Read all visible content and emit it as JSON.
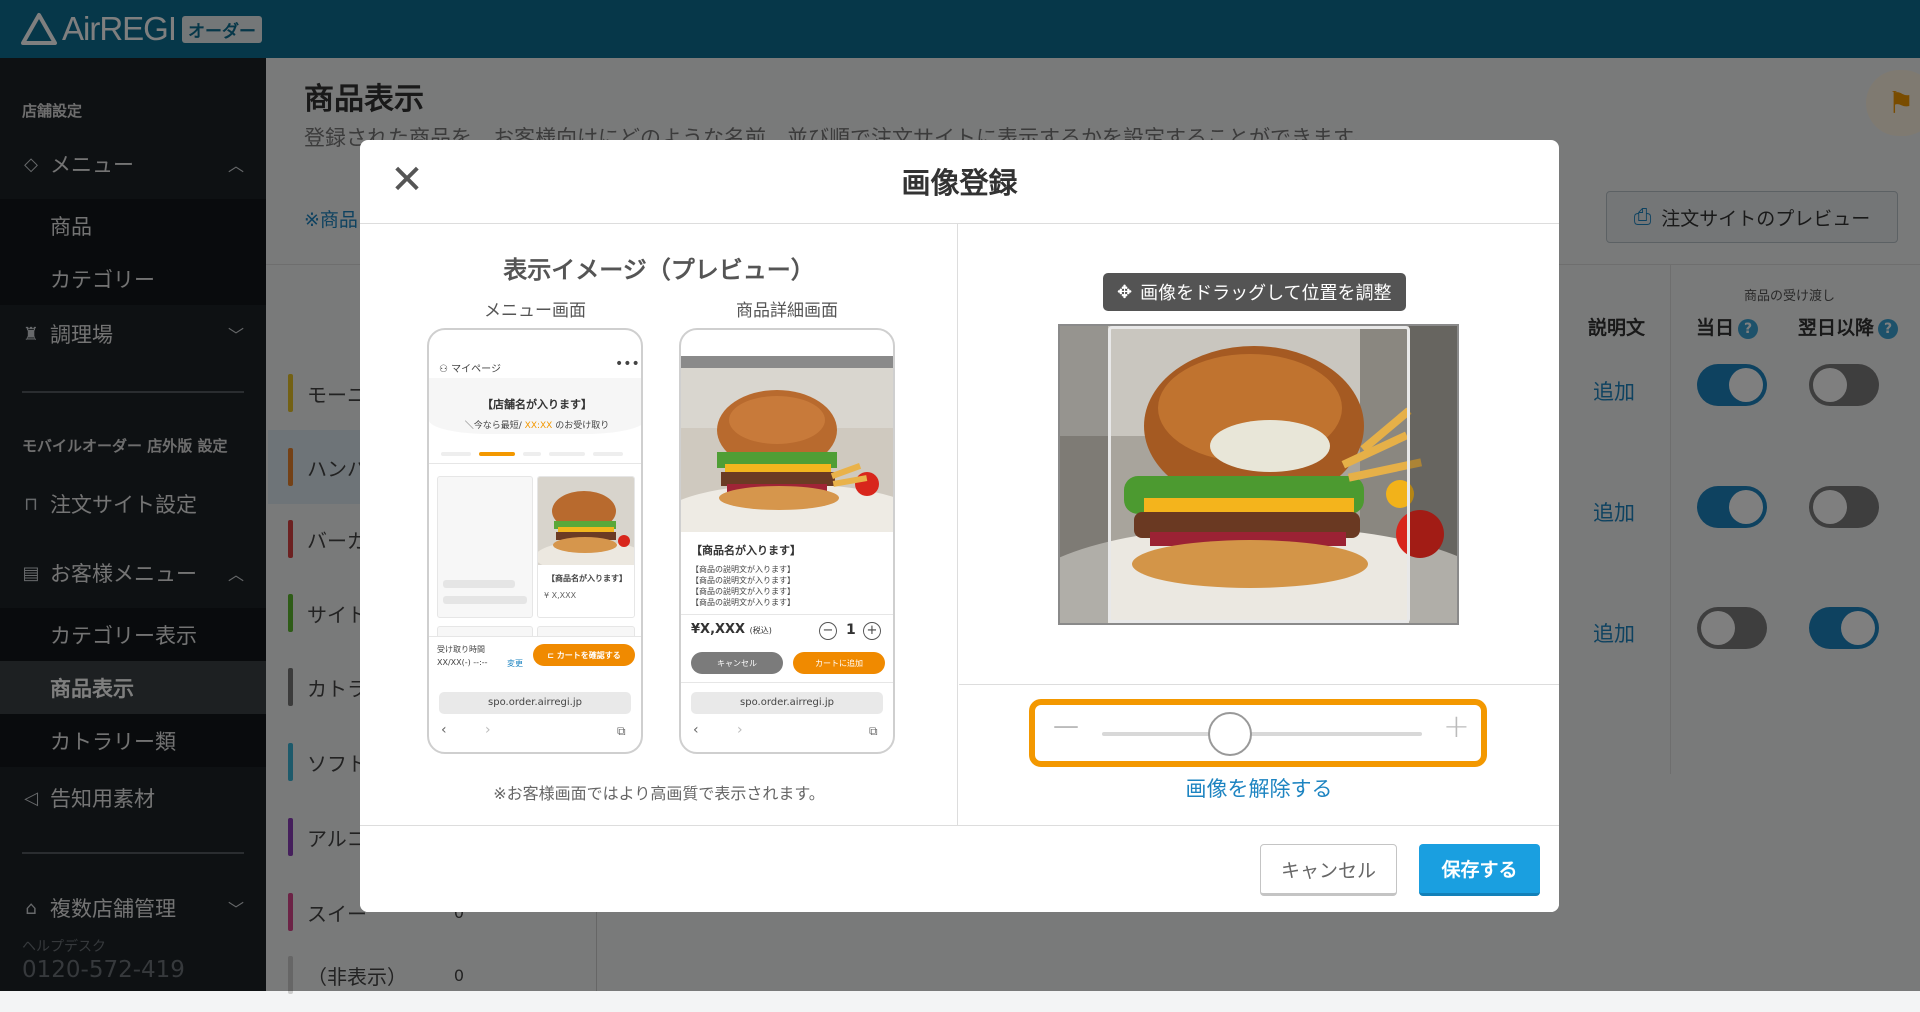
{
  "app": {
    "logo_text": "AirREGI",
    "logo_badge": "オーダー"
  },
  "sidebar": {
    "section1": "店舗設定",
    "menu_label": "メニュー",
    "menu_items": [
      "商品",
      "カテゴリー"
    ],
    "kitchen_label": "調理場",
    "section2": "モバイルオーダー 店外版 設定",
    "order_site_label": "注文サイト設定",
    "customer_menu_label": "お客様メニュー",
    "customer_menu_items": [
      "カテゴリー表示",
      "商品表示",
      "カトラリー類"
    ],
    "active_item": "商品表示",
    "notice_label": "告知用素材",
    "multi_store_label": "複数店舗管理",
    "helpdesk_label": "ヘルプデスク",
    "helpdesk_phone": "0120-572-419"
  },
  "main": {
    "title": "商品表示",
    "description": "登録された商品を、お客様向けにどのような名前、並び順で注文サイトに表示するかを設定することができます。",
    "notice_prefix": "※商品",
    "preview_button": "注文サイトのプレビュー",
    "header_group": "商品の受け渡し",
    "col_description": "説明文",
    "col_today": "当日",
    "col_next_day": "翌日以降",
    "categories": [
      {
        "name": "モーニ",
        "color": "#e6c229"
      },
      {
        "name": "ハンバ",
        "color": "#e8822c"
      },
      {
        "name": "バーガ",
        "color": "#d94343"
      },
      {
        "name": "サイト",
        "color": "#5cb82f"
      },
      {
        "name": "カトラ",
        "color": "#777777"
      },
      {
        "name": "ソフト",
        "color": "#3bb4d6"
      },
      {
        "name": "アルコ",
        "color": "#8b3fb8"
      },
      {
        "name": "スイー",
        "color": "#d9478c"
      },
      {
        "name": "（非表示）",
        "color": "#cccccc"
      }
    ],
    "category_count_partial": "0",
    "rows": [
      {
        "add_label": "追加",
        "today": true,
        "next_day": false
      },
      {
        "add_label": "追加",
        "today": true,
        "next_day": false
      },
      {
        "add_label": "追加",
        "today": false,
        "next_day": true
      }
    ]
  },
  "modal": {
    "title": "画像登録",
    "preview_heading": "表示イメージ（プレビュー）",
    "menu_screen_label": "メニュー画面",
    "detail_screen_label": "商品詳細画面",
    "note": "※お客様画面ではより高画質で表示されます。",
    "drag_tip": "画像をドラッグして位置を調整",
    "remove_image": "画像を解除する",
    "zoom_level": 0.4,
    "cancel_button": "キャンセル",
    "save_button": "保存する",
    "menu_mock": {
      "mypage": "マイページ",
      "store_name": "【店舗名が入ります】",
      "pickup_prefix": "＼今なら最短/",
      "pickup_time": "XX:XX",
      "pickup_suffix": "のお受け取り",
      "product_name": "【商品名が入ります】",
      "price": "¥ X,XXX",
      "pickup_label": "受け取り時間",
      "pickup_value": "XX/XX(-) --:--",
      "change": "変更",
      "cart_button": "カートを確認する",
      "url": "spo.order.airregi.jp"
    },
    "detail_mock": {
      "product_name": "【商品名が入ります】",
      "desc_line": "【商品の説明文が入ります】",
      "price": "¥X,XXX",
      "tax": "(税込)",
      "qty": "1",
      "cancel": "キャンセル",
      "add_cart": "カートに追加",
      "url": "spo.order.airregi.jp"
    }
  },
  "colors": {
    "topbar": "#0d6f93",
    "accent": "#1d84c1",
    "highlight": "#f39800",
    "save": "#1a9fe0"
  }
}
